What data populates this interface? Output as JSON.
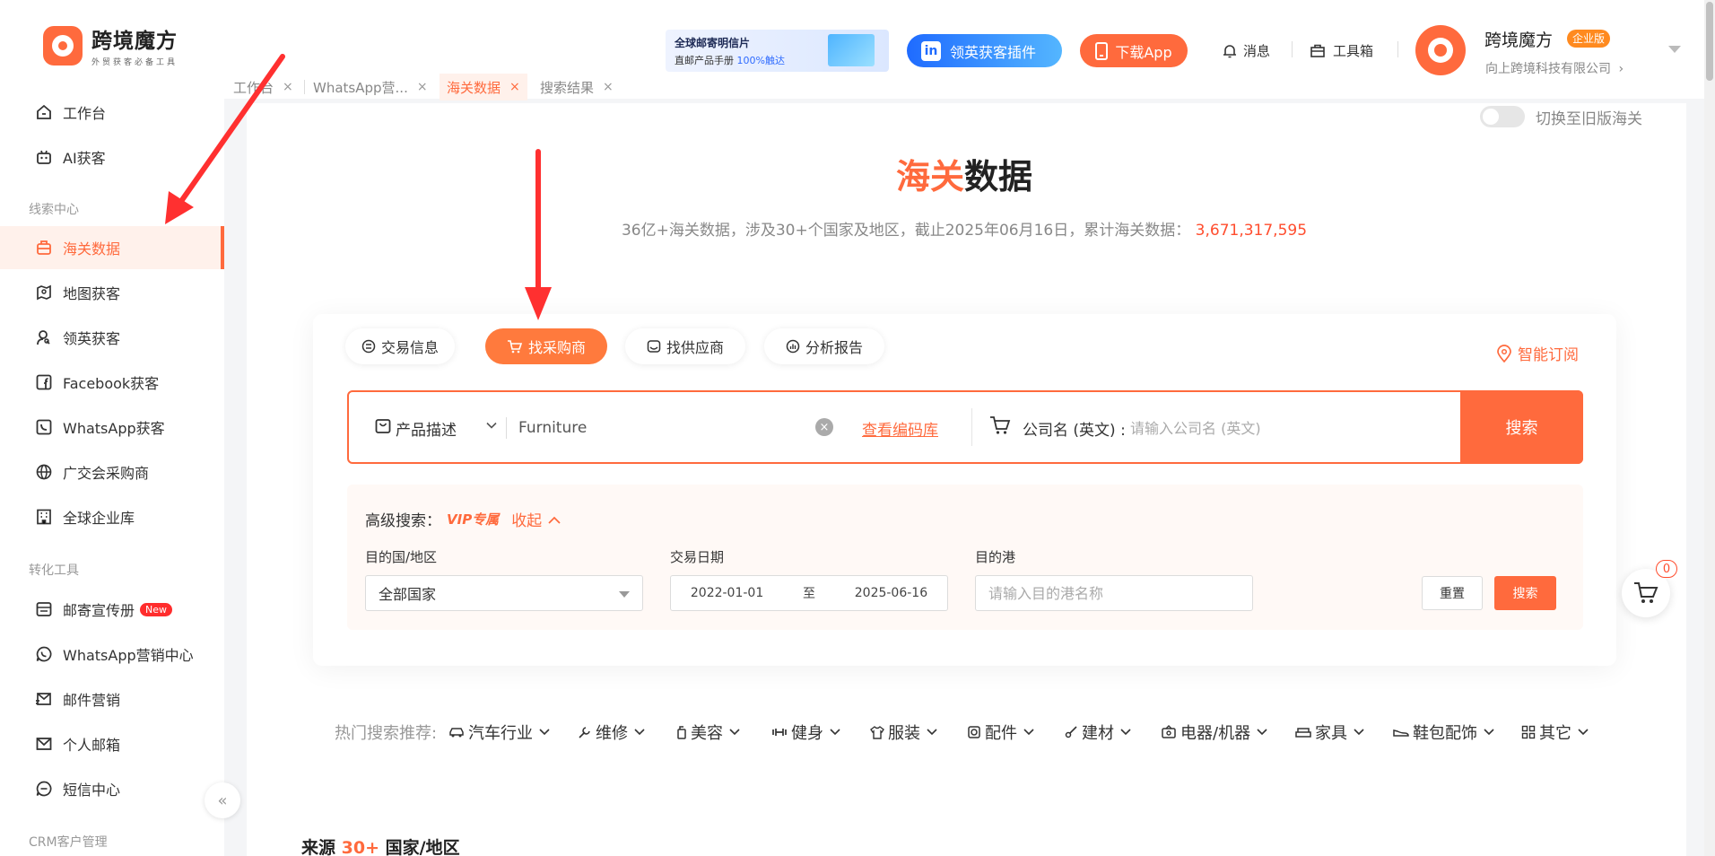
{
  "header": {
    "logo_name": "跨境魔方",
    "logo_slogan": "外贸获客必备工具",
    "banner_line1": "全球邮寄明信片",
    "banner_line2_prefix": "直邮产品手册",
    "banner_line2_highlight": "100%触达",
    "linkedin_label": "领英获客插件",
    "download_label": "下载App",
    "messages_label": "消息",
    "toolbox_label": "工具箱",
    "user_name": "跨境魔方",
    "user_badge": "企业版",
    "user_company": "向上跨境科技有限公司",
    "company_chevron": "›"
  },
  "sidebar": {
    "items_top": [
      {
        "label": "工作台",
        "icon": "home-icon"
      },
      {
        "label": "AI获客",
        "icon": "robot-icon"
      }
    ],
    "section_leads": "线索中心",
    "items_leads": [
      {
        "label": "海关数据",
        "icon": "customs-icon",
        "active": true
      },
      {
        "label": "地图获客",
        "icon": "map-icon"
      },
      {
        "label": "领英获客",
        "icon": "user-search-icon"
      },
      {
        "label": "Facebook获客",
        "icon": "facebook-icon"
      },
      {
        "label": "WhatsApp获客",
        "icon": "whatsapp-icon"
      },
      {
        "label": "广交会采购商",
        "icon": "globe-icon"
      },
      {
        "label": "全球企业库",
        "icon": "building-icon"
      }
    ],
    "section_convert": "转化工具",
    "items_convert": [
      {
        "label": "邮寄宣传册",
        "icon": "brochure-icon",
        "badge": "New"
      },
      {
        "label": "WhatsApp营销中心",
        "icon": "whatsapp-icon"
      },
      {
        "label": "邮件营销",
        "icon": "mail-send-icon"
      },
      {
        "label": "个人邮箱",
        "icon": "mail-icon"
      },
      {
        "label": "短信中心",
        "icon": "sms-icon"
      }
    ],
    "section_crm": "CRM客户管理",
    "collapse_glyph": "«"
  },
  "tabs": [
    {
      "label": "工作台"
    },
    {
      "label": "WhatsApp营..."
    },
    {
      "label": "海关数据",
      "active": true
    },
    {
      "label": "搜索结果"
    }
  ],
  "tab_close": "×",
  "toggle_label": "切换至旧版海关",
  "title": {
    "highlight": "海关",
    "rest": "数据"
  },
  "subtitle": {
    "text": "36亿+海关数据，涉及30+个国家及地区，截止2025年06月16日，累计海关数据：",
    "number": "3,671,317,595"
  },
  "mode_tabs": [
    {
      "label": "交易信息",
      "icon": "trade-icon"
    },
    {
      "label": "找采购商",
      "icon": "cart-icon",
      "active": true
    },
    {
      "label": "找供应商",
      "icon": "supplier-icon"
    },
    {
      "label": "分析报告",
      "icon": "report-icon"
    }
  ],
  "subscribe_label": "智能订阅",
  "search": {
    "field_select": "产品描述",
    "product_value": "Furniture",
    "clear_glyph": "×",
    "hscode_link": "查看编码库",
    "company_label": "公司名 (英文) :",
    "company_placeholder": "请输入公司名 (英文)",
    "search_button": "搜索"
  },
  "advanced": {
    "title": "高级搜索：",
    "vip": "VIP专属",
    "collapse": "收起",
    "country_label": "目的国/地区",
    "country_value": "全部国家",
    "date_label": "交易日期",
    "date_from": "2022-01-01",
    "date_sep": "至",
    "date_to": "2025-06-16",
    "port_label": "目的港",
    "port_placeholder": "请输入目的港名称",
    "reset_button": "重置",
    "search_button": "搜索"
  },
  "cart_count": "0",
  "hot": {
    "label": "热门搜索推荐:",
    "items": [
      {
        "label": "汽车行业",
        "icon": "car-icon"
      },
      {
        "label": "维修",
        "icon": "wrench-icon"
      },
      {
        "label": "美容",
        "icon": "bottle-icon"
      },
      {
        "label": "健身",
        "icon": "dumbbell-icon"
      },
      {
        "label": "服装",
        "icon": "shirt-icon"
      },
      {
        "label": "配件",
        "icon": "part-icon"
      },
      {
        "label": "建材",
        "icon": "brush-icon"
      },
      {
        "label": "电器/机器",
        "icon": "appliance-icon"
      },
      {
        "label": "家具",
        "icon": "sofa-icon"
      },
      {
        "label": "鞋包配饰",
        "icon": "shoe-icon"
      },
      {
        "label": "其它",
        "icon": "grid-icon"
      }
    ]
  },
  "source": {
    "prefix": "来源",
    "highlight": "30+",
    "suffix": "国家/地区"
  },
  "colors": {
    "accent": "#ff6a3d",
    "linkedin": "#1f6bff",
    "annotation_arrow": "#ff3030"
  }
}
